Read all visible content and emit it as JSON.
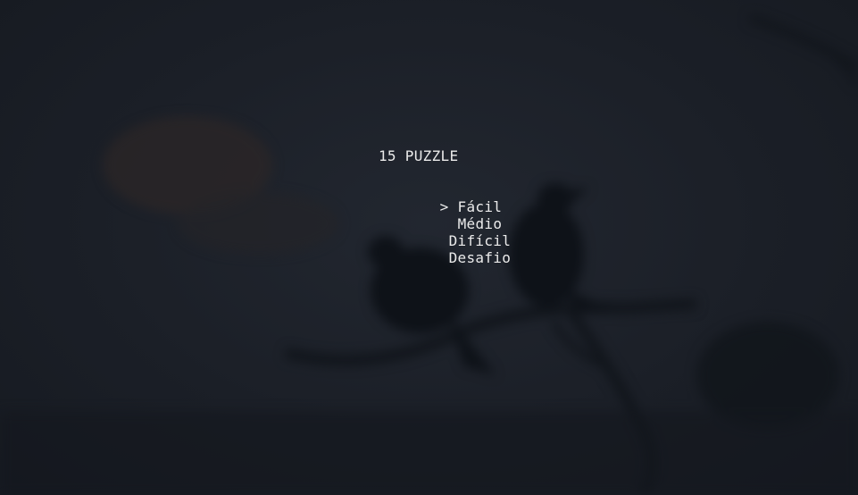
{
  "game": {
    "title": "15 PUZZLE",
    "cursor": ">",
    "selected_index": 0,
    "menu_options": [
      {
        "label": "Fácil"
      },
      {
        "label": "Médio"
      },
      {
        "label": "Difícil"
      },
      {
        "label": "Desafio"
      }
    ]
  },
  "colors": {
    "background": "#1a1e25",
    "text": "#ebebeb",
    "bird_silhouette": "#0d1118"
  }
}
